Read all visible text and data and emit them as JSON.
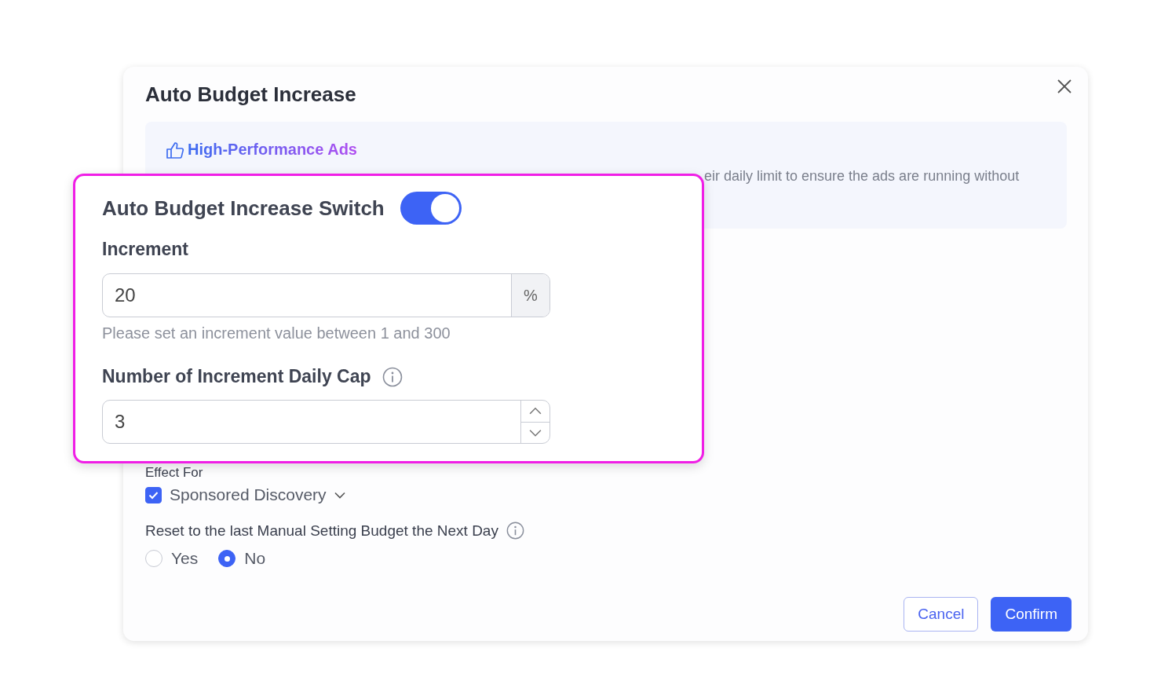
{
  "dialog": {
    "title": "Auto Budget Increase",
    "banner": {
      "heading": "High-Performance Ads",
      "text": "eir daily limit to ensure the ads are running without"
    },
    "effect_for": {
      "label": "Effect For",
      "option": {
        "label": "Sponsored Discovery",
        "checked": true
      }
    },
    "reset": {
      "label": "Reset to the last Manual Setting Budget the Next Day",
      "options": [
        {
          "label": "Yes",
          "selected": false
        },
        {
          "label": "No",
          "selected": true
        }
      ]
    },
    "buttons": [
      {
        "label": "Cancel",
        "kind": "secondary"
      },
      {
        "label": "Confirm",
        "kind": "primary"
      }
    ]
  },
  "callout": {
    "switch": {
      "label": "Auto Budget Increase Switch",
      "on": true
    },
    "increment": {
      "label": "Increment",
      "value": "20",
      "suffix": "%",
      "help": "Please set an increment value between 1 and 300"
    },
    "daily_cap": {
      "label": "Number of Increment Daily Cap",
      "value": "3"
    }
  }
}
